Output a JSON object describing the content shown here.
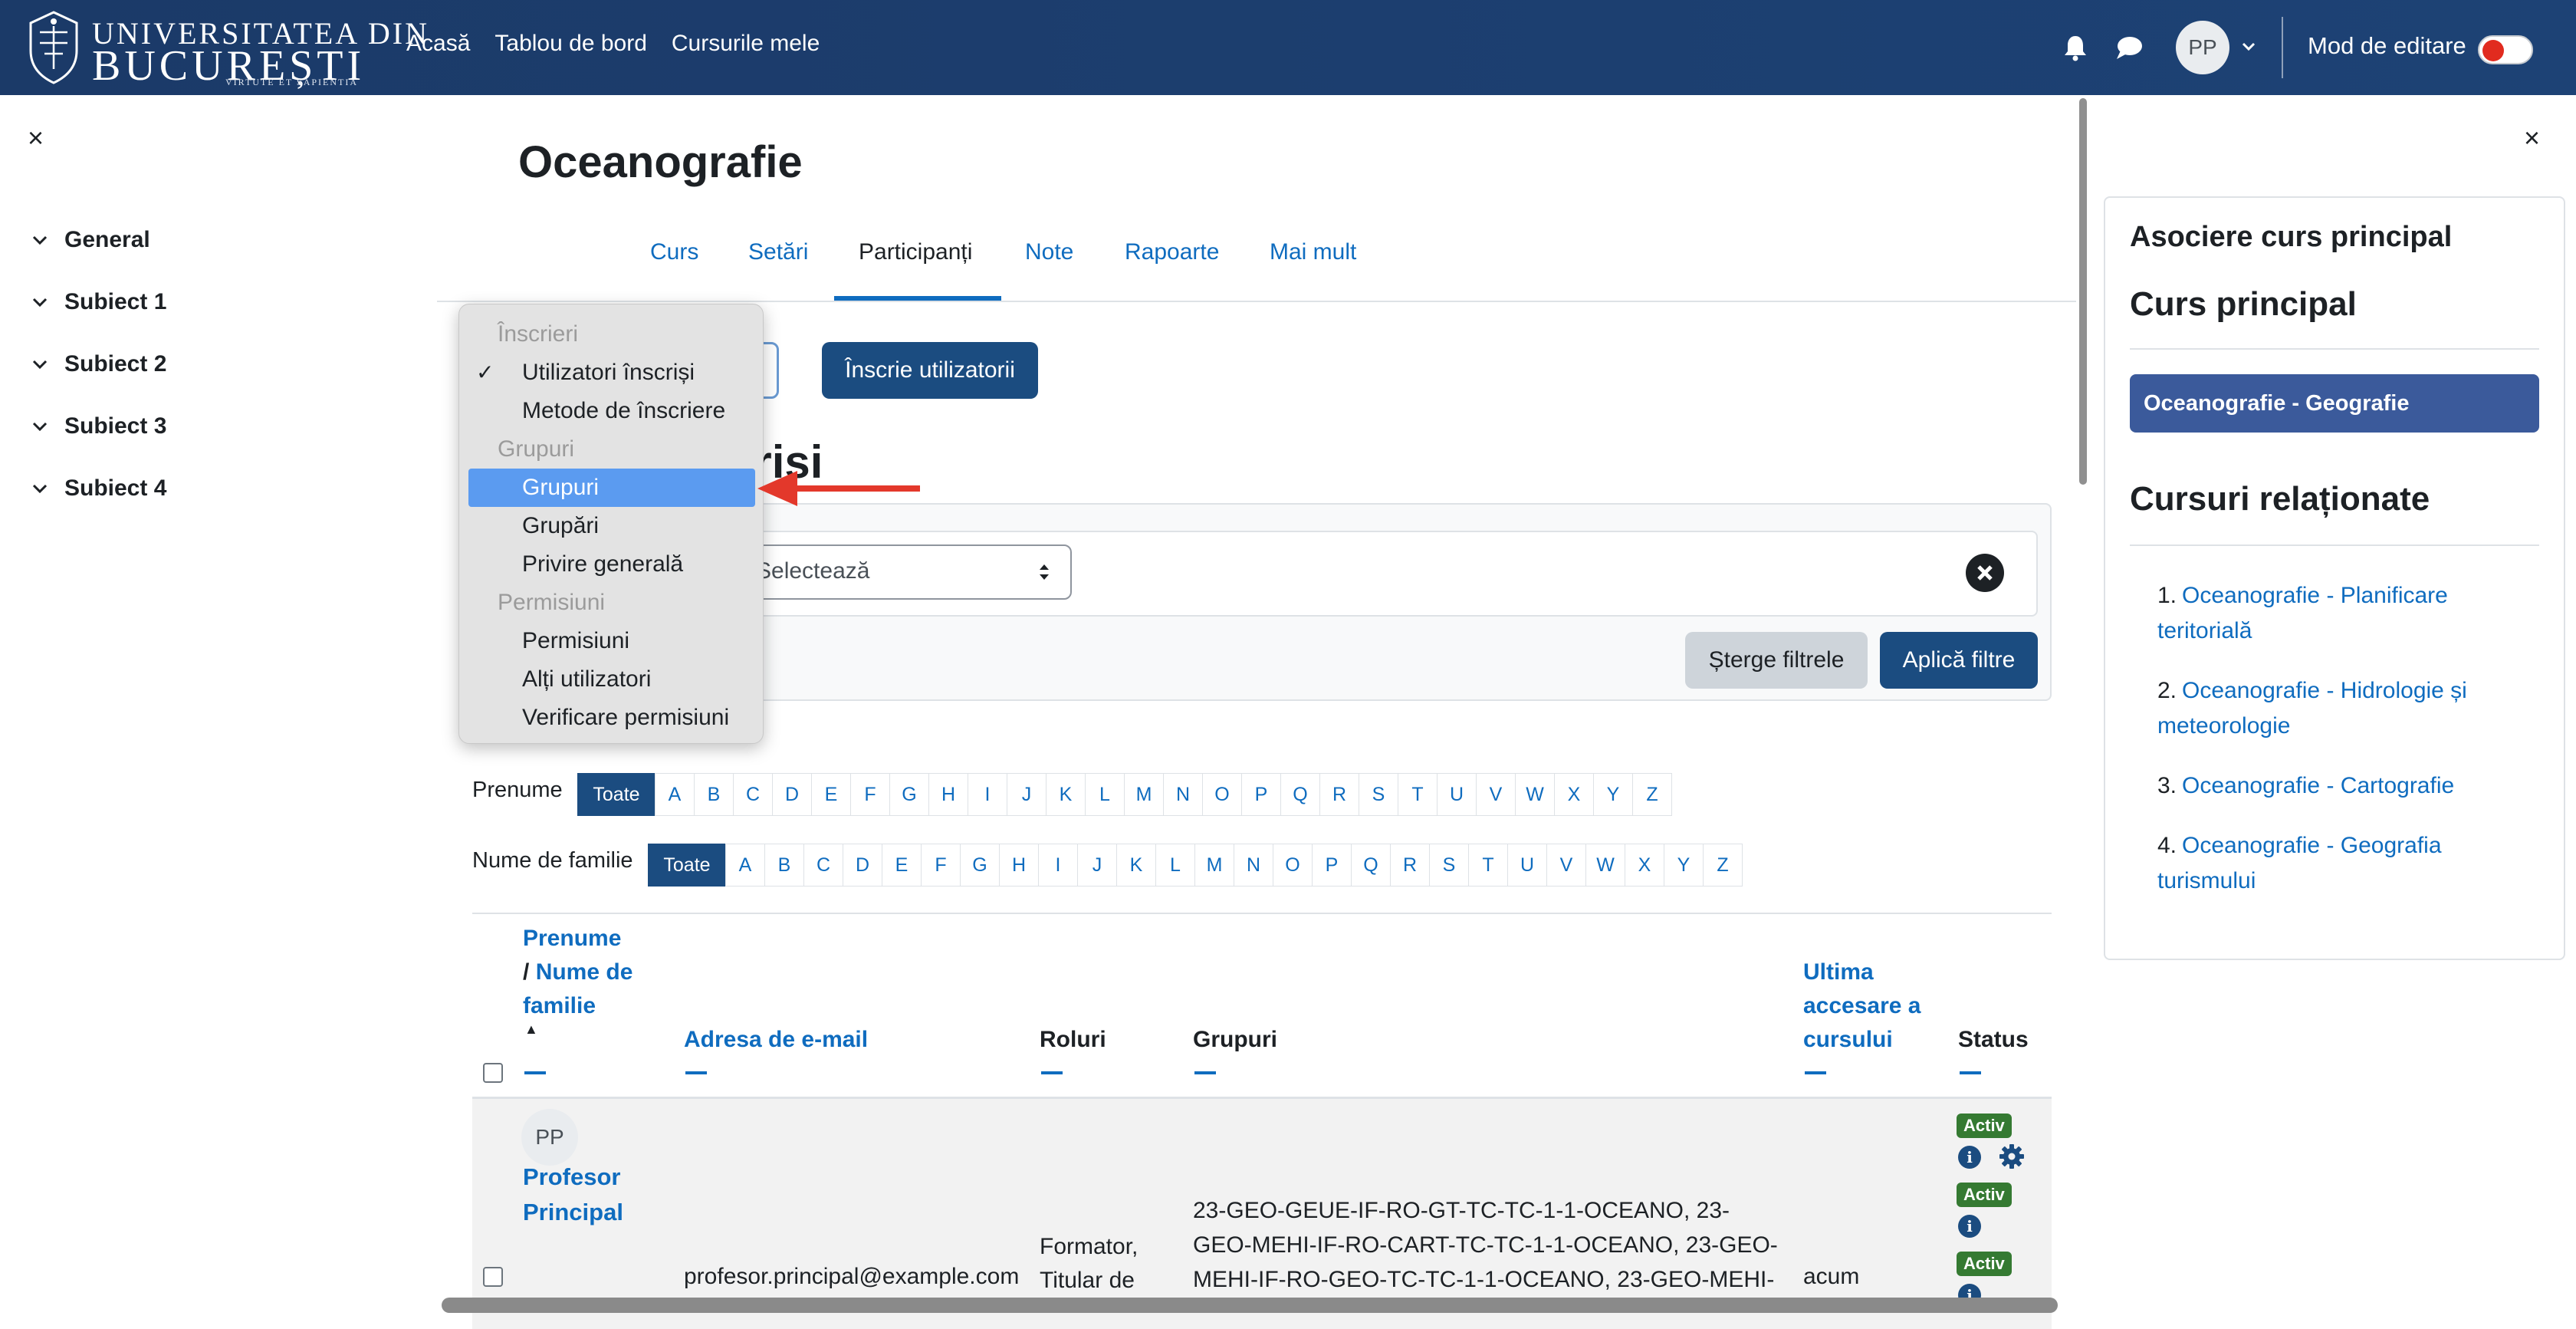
{
  "navbar": {
    "logo": {
      "line1": "UNIVERSITATEA DIN",
      "line2": "BUCUREȘTI",
      "motto": "VIRTUTE ET SAPIENTIA"
    },
    "links": [
      "Acasă",
      "Tablou de bord",
      "Cursurile mele"
    ],
    "avatar_initials": "PP",
    "edit_mode_label": "Mod de editare",
    "edit_mode_on": false
  },
  "left_drawer": {
    "close_symbol": "×",
    "sections": [
      "General",
      "Subiect 1",
      "Subiect 2",
      "Subiect 3",
      "Subiect 4"
    ]
  },
  "course": {
    "title": "Oceanografie",
    "tabs": [
      "Curs",
      "Setări",
      "Participanți",
      "Note",
      "Rapoarte",
      "Mai mult"
    ],
    "active_tab": "Participanți"
  },
  "participants": {
    "enrol_button": "Înscrie utilizatorii",
    "heading_partial": "crisi",
    "filter_select_placeholder": "Selectează",
    "clear_filters": "Șterge filtrele",
    "apply_filters": "Aplică filtre"
  },
  "dropdown": {
    "groups": [
      {
        "label": "Înscrieri",
        "options": [
          {
            "label": "Utilizatori înscriși",
            "checked": true
          },
          {
            "label": "Metode de înscriere"
          }
        ]
      },
      {
        "label": "Grupuri",
        "options": [
          {
            "label": "Grupuri",
            "highlighted": true
          },
          {
            "label": "Grupări"
          },
          {
            "label": "Privire generală"
          }
        ]
      },
      {
        "label": "Permisiuni",
        "options": [
          {
            "label": "Permisiuni"
          },
          {
            "label": "Alți utilizatori"
          },
          {
            "label": "Verificare permisiuni"
          }
        ]
      }
    ],
    "check_symbol": "✓"
  },
  "initials": {
    "first_name_label": "Prenume",
    "last_name_label": "Nume de familie",
    "all_label": "Toate",
    "letters": [
      "A",
      "B",
      "C",
      "D",
      "E",
      "F",
      "G",
      "H",
      "I",
      "J",
      "K",
      "L",
      "M",
      "N",
      "O",
      "P",
      "Q",
      "R",
      "S",
      "T",
      "U",
      "V",
      "W",
      "X",
      "Y",
      "Z"
    ]
  },
  "table": {
    "headers": {
      "first_name": "Prenume",
      "separator": "/",
      "last_name": "Nume de familie",
      "email": "Adresa de e-mail",
      "roles": "Roluri",
      "groups": "Grupuri",
      "last_access": "Ultima accesare a cursului",
      "status": "Status"
    },
    "sort_indicator": "▲",
    "rows": [
      {
        "initials": "PP",
        "name": "Profesor Principal",
        "email": "profesor.principal@example.com",
        "roles": "Formator, Titular de",
        "groups": "23-GEO-GEUE-IF-RO-GT-TC-TC-1-1-OCEANO, 23-GEO-MEHI-IF-RO-CART-TC-TC-1-1-OCEANO, 23-GEO-MEHI-IF-RO-GEO-TC-TC-1-1-OCEANO, 23-GEO-MEHI-",
        "last_access": "acum",
        "status_badges": [
          "Activ",
          "Activ",
          "Activ"
        ],
        "info_symbol": "i"
      }
    ]
  },
  "right_drawer": {
    "close_symbol": "×",
    "block_title": "Asociere curs principal",
    "main_course_heading": "Curs principal",
    "main_course": "Oceanografie - Geografie",
    "related_heading": "Cursuri relaționate",
    "related": [
      {
        "num": "1.",
        "label": "Oceanografie - Planificare teritorială"
      },
      {
        "num": "2.",
        "label": "Oceanografie - Hidrologie și meteorologie"
      },
      {
        "num": "3.",
        "label": "Oceanografie - Cartografie"
      },
      {
        "num": "4.",
        "label": "Oceanografie - Geografia turismului"
      }
    ]
  },
  "colors": {
    "navbar": "#1c3e6e",
    "primary": "#1b4c80",
    "link": "#0f6cbf",
    "badge_success": "#357a32",
    "dropdown_highlight": "#5b9bf0",
    "annotation_arrow": "#e3382b"
  }
}
